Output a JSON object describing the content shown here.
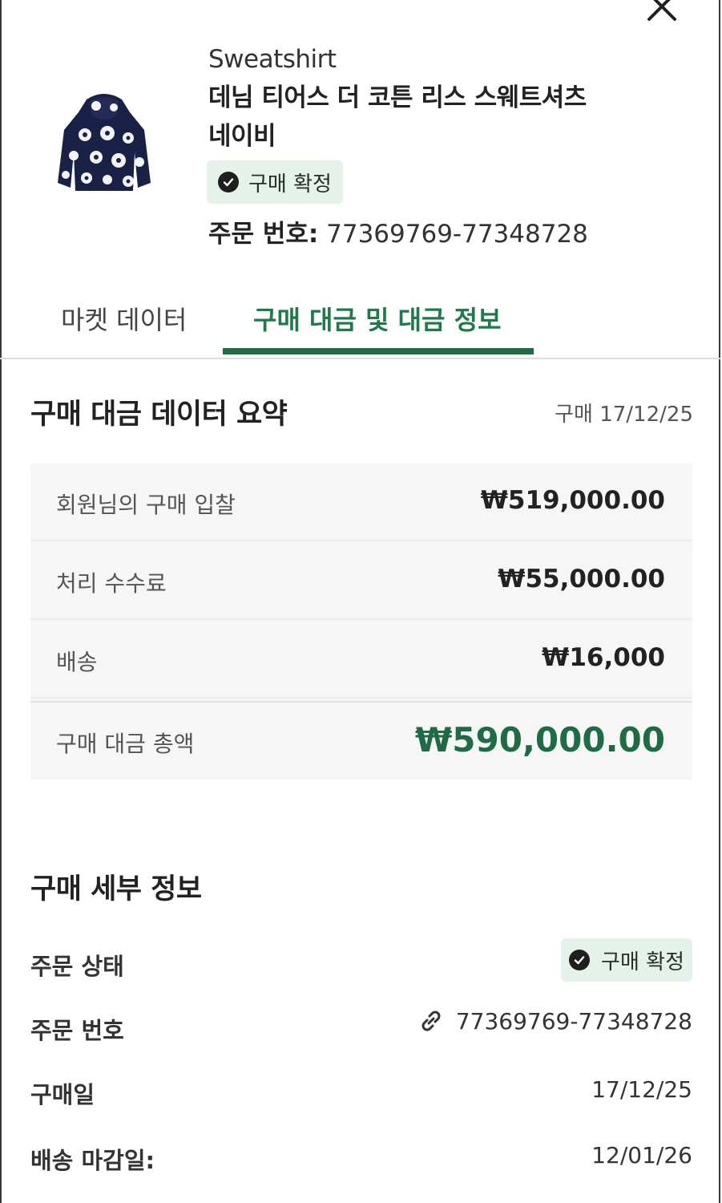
{
  "product": {
    "image_icon": "navy-floral-hoodie-image",
    "category": "Sweatshirt",
    "name_line1": "데님 티어스 더 코튼 리스 스웨트셔츠",
    "name_line2": "네이비",
    "status": "구매 확정",
    "order_label": "주문 번호:",
    "order_number": " 77369769-77348728"
  },
  "tabs": [
    {
      "label": "마켓 데이터",
      "active": false
    },
    {
      "label": "구매 대금 및 대금 정보",
      "active": true
    }
  ],
  "summary": {
    "title": "구매 대금 데이터 요약",
    "date": "구매 17/12/25",
    "rows": [
      {
        "label": "회원님의 구매 입찰",
        "value": "₩519,000.00"
      },
      {
        "label": "처리 수수료",
        "value": "₩55,000.00"
      },
      {
        "label": "배송",
        "value": "₩16,000"
      }
    ],
    "total": {
      "label": "구매 대금 총액",
      "value": "₩590,000.00"
    }
  },
  "details": {
    "title": "구매 세부 정보",
    "rows": [
      {
        "label": "주문 상태",
        "value": "구매 확정"
      },
      {
        "label": "주문 번호",
        "value": "77369769-77348728"
      },
      {
        "label": "구매일",
        "value": "17/12/25"
      },
      {
        "label": "배송 마감일:",
        "value": "12/01/26"
      }
    ]
  },
  "colors": {
    "accent": "#1e6b45",
    "badge_bg": "#e4f2ea",
    "summary_bg": "#f6f6f6"
  },
  "icons": {
    "close": "close-icon",
    "check": "check-circle-icon",
    "link": "link-icon"
  }
}
